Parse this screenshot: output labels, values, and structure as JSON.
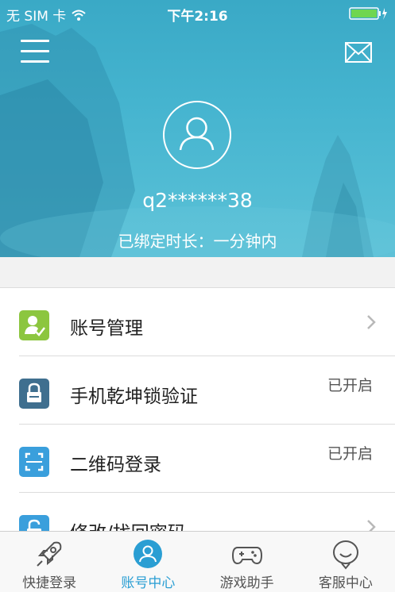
{
  "status_bar": {
    "carrier": "无 SIM 卡",
    "time": "下午2:16"
  },
  "header": {
    "menu_icon": "hamburger-menu-icon",
    "mail_icon": "envelope-icon",
    "avatar_icon": "user-avatar-icon",
    "username": "q2******38",
    "bind_info": "已绑定时长：一分钟内"
  },
  "list": [
    {
      "label": "账号管理",
      "status": "",
      "icon": "account-manage-icon",
      "icon_color": "#8cc63f",
      "chevron": true
    },
    {
      "label": "手机乾坤锁验证",
      "status": "已开启",
      "icon": "lock-icon",
      "icon_color": "#3f6f8f",
      "chevron": false
    },
    {
      "label": "二维码登录",
      "status": "已开启",
      "icon": "qr-scan-icon",
      "icon_color": "#3a9fdc",
      "chevron": false
    },
    {
      "label": "修改/找回密码",
      "status": "",
      "icon": "unlock-icon",
      "icon_color": "#3a9fdc",
      "chevron": true
    }
  ],
  "tabbar": [
    {
      "label": "快捷登录",
      "icon": "rocket-icon",
      "active": false
    },
    {
      "label": "账号中心",
      "icon": "user-circle-icon",
      "active": true
    },
    {
      "label": "游戏助手",
      "icon": "gamepad-icon",
      "active": false
    },
    {
      "label": "客服中心",
      "icon": "chat-bubble-icon",
      "active": false
    }
  ],
  "colors": {
    "accent": "#2a9ed3",
    "hero": "#45b4cf"
  }
}
